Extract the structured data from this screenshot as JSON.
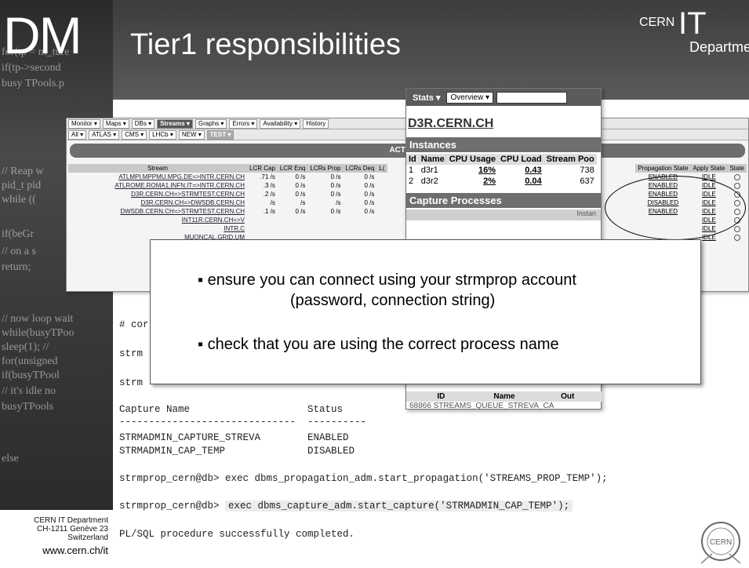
{
  "slide": {
    "logo": "DM",
    "title": "Tier1 responsibilities",
    "brand": {
      "cern": "CERN",
      "it": "IT",
      "department": "Department"
    }
  },
  "left_code_lines": [
    "for(tp = m_ture",
    "if(tp->second",
    "busy TPools.p",
    "// Reap w",
    "pid_t pid",
    "while ((",
    "if(beGr",
    "// on a s",
    "return;",
    "// now loop wait",
    "while(busyTPoo",
    "sleep(1); //",
    "for(unsigned",
    "if(busyTPool",
    "// it's idle no",
    "busyTPools",
    "else"
  ],
  "footer": {
    "line1": "CERN IT Department",
    "line2": "CH-1211 Genève 23",
    "line3": "Switzerland",
    "url": "www.cern.ch/it"
  },
  "monitor": {
    "menu_row1": [
      "Monitor ▾",
      "Maps ▾",
      "DBs ▾",
      "Streams ▾",
      "Graphs ▾",
      "Errors ▾",
      "Availability ▾",
      "History"
    ],
    "menu_row1_active": "Streams",
    "menu_row2": [
      "All ▾",
      "ATLAS ▾",
      "CMS ▾",
      "LHCb ▾",
      "NEW ▾",
      "TEST ▾"
    ],
    "active_label": "ACTIVE S",
    "columns": [
      "Stream",
      "LCR Cap",
      "LCR Enq",
      "LCRs Prop",
      "LCRs Deq",
      "L("
    ],
    "rows": [
      [
        "ATLMPI.MPPMU.MPG.DE=>INTR.CERN.CH",
        ".71 /s",
        "0 /s",
        "0 /s",
        "0 /s"
      ],
      [
        "ATLROME.ROMA1.INFN.IT=>INTR.CERN.CH",
        ".3 /s",
        "0 /s",
        "0 /s",
        "0 /s"
      ],
      [
        "D3R.CERN.CH=>STRMTEST.CERN.CH",
        ".2 /s",
        "0 /s",
        "0 /s",
        "0 /s"
      ],
      [
        "D3R.CERN.CH=>DWSDB.CERN.CH",
        "/s",
        "/s",
        "/s",
        "0 /s"
      ],
      [
        "DWSDB.CERN.CH=>STRMTEST.CERN.CH",
        ".1 /s",
        "0 /s",
        "0 /s",
        "0 /s"
      ],
      [
        "INT11R.CERN.CH=>V",
        "",
        "",
        "",
        ""
      ],
      [
        "INTR.C",
        "",
        "",
        "",
        ""
      ],
      [
        "MUONCAL.GRID.UM",
        "",
        "",
        "",
        ""
      ]
    ],
    "right_columns": [
      "Propagation State",
      "Apply State",
      "State"
    ],
    "right_rows": [
      [
        "ENABLED",
        "IDLE"
      ],
      [
        "ENABLED",
        "IDLE"
      ],
      [
        "ENABLED",
        "IDLE"
      ],
      [
        "DISABLED",
        "IDLE"
      ],
      [
        "ENABLED",
        "IDLE"
      ],
      [
        "",
        "IDLE"
      ],
      [
        "",
        "IDLE"
      ],
      [
        "",
        "IDLE"
      ]
    ]
  },
  "stats": {
    "tab": "Stats ▾",
    "overview": "Overview ▾",
    "host": "D3R.CERN.CH",
    "instances_title": "Instances",
    "inst_columns": [
      "Id",
      "Name",
      "CPU Usage",
      "CPU Load",
      "Stream Poo"
    ],
    "inst_rows": [
      [
        "1",
        "d3r1",
        "16%",
        "0.43",
        "738"
      ],
      [
        "2",
        "d3r2",
        "2%",
        "0.04",
        "637"
      ]
    ],
    "capture_title": "Capture Processes",
    "capture_head": "Instan",
    "bottom_columns": [
      "ID",
      "Name",
      "Out"
    ],
    "bottom_row": "68866 STREAMS_QUEUE_STREVA_CA"
  },
  "bullets": {
    "b1_line1": "▪ ensure you can connect using your strmprop account",
    "b1_line2": "(password, connection string)",
    "b2": "▪ check that you are using the correct process name"
  },
  "terminal": {
    "l1": "# cor",
    "l2": "strm",
    "l3": "strm",
    "capture_header": "Capture Name                    Status",
    "separator": "------------------------------  ----------",
    "row1": "STRMADMIN_CAPTURE_STREVA        ENABLED",
    "row2": "STRMADMIN_CAP_TEMP              DISABLED",
    "cmd1_prompt": "strmprop_cern@db> ",
    "cmd1": "exec dbms_propagation_adm.start_propagation('STREAMS_PROP_TEMP');",
    "cmd2_prompt": "strmprop_cern@db> ",
    "cmd2": "exec dbms_capture_adm.start_capture('STRMADMIN_CAP_TEMP');",
    "result": "PL/SQL procedure successfully completed."
  }
}
